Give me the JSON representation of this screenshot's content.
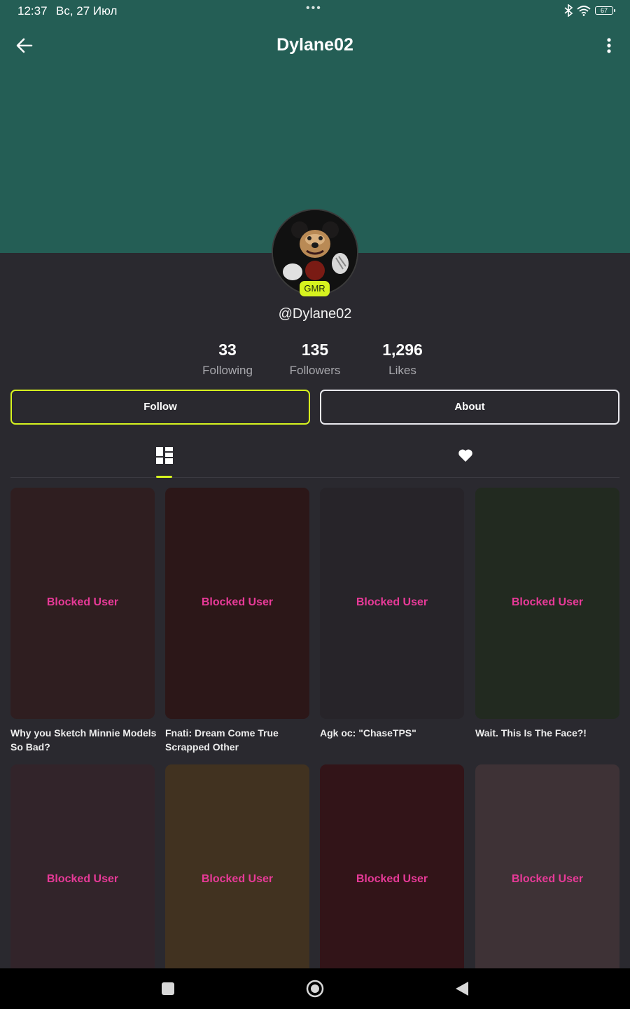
{
  "status_bar": {
    "time": "12:37",
    "date": "Вс, 27 Июл",
    "dots": "•••",
    "battery_level": "67"
  },
  "header": {
    "title": "Dylane02"
  },
  "profile": {
    "badge": "GMR",
    "handle": "@Dylane02",
    "stats": [
      {
        "value": "33",
        "label": "Following"
      },
      {
        "value": "135",
        "label": "Followers"
      },
      {
        "value": "1,296",
        "label": "Likes"
      }
    ]
  },
  "actions": {
    "follow_label": "Follow",
    "about_label": "About"
  },
  "tabs": [
    {
      "icon": "grid-layout-icon",
      "active": true
    },
    {
      "icon": "heart-icon",
      "active": false
    }
  ],
  "grid": [
    {
      "label": "Blocked User",
      "caption": "Why you Sketch Minnie Models So Bad?",
      "bg": "#2f1e20"
    },
    {
      "label": "Blocked User",
      "caption": "Fnati: Dream Come True Scrapped Other",
      "bg": "#2c1718"
    },
    {
      "label": "Blocked User",
      "caption": "Agk oc: \"ChaseTPS\"",
      "bg": "#272429"
    },
    {
      "label": "Blocked User",
      "caption": "Wait. This Is The Face?!",
      "bg": "#222a20"
    },
    {
      "label": "Blocked User",
      "caption": "",
      "bg": "#32242a"
    },
    {
      "label": "Blocked User",
      "caption": "",
      "bg": "#413220"
    },
    {
      "label": "Blocked User",
      "caption": "",
      "bg": "#321418"
    },
    {
      "label": "Blocked User",
      "caption": "",
      "bg": "#3e3236"
    }
  ],
  "colors": {
    "banner": "#245e55",
    "background": "#2a292f",
    "accent": "#d6f31f",
    "blocked_text": "#e83a98"
  }
}
